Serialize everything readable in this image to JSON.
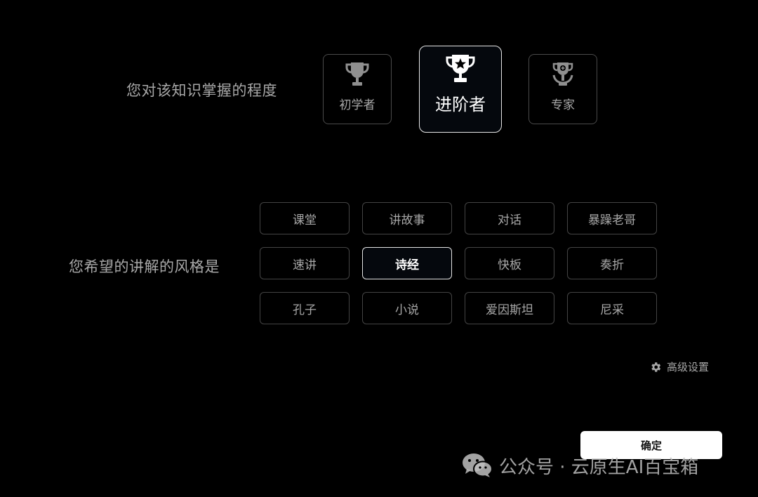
{
  "level_section": {
    "label": "您对该知识掌握的程度",
    "options": [
      {
        "name": "初学者",
        "icon": "trophy-icon",
        "selected": false
      },
      {
        "name": "进阶者",
        "icon": "star-trophy-icon",
        "selected": true
      },
      {
        "name": "专家",
        "icon": "wreath-trophy-icon",
        "selected": false
      }
    ]
  },
  "style_section": {
    "label": "您希望的讲解的风格是",
    "options": [
      "课堂",
      "讲故事",
      "对话",
      "暴躁老哥",
      "速讲",
      "诗经",
      "快板",
      "奏折",
      "孔子",
      "小说",
      "爱因斯坦",
      "尼采"
    ],
    "selected": "诗经"
  },
  "advanced_settings": {
    "label": "高级设置",
    "icon": "gear-icon"
  },
  "confirm_button": {
    "label": "确定"
  },
  "watermark": {
    "text": "公众号 · 云原生AI百宝箱",
    "icon": "wechat-icon"
  },
  "colors": {
    "background": "#000000",
    "selected_border": "#e8e8e8",
    "border": "#4a4a4a",
    "text_muted": "#a8a8a8",
    "text_active": "#ffffff"
  }
}
